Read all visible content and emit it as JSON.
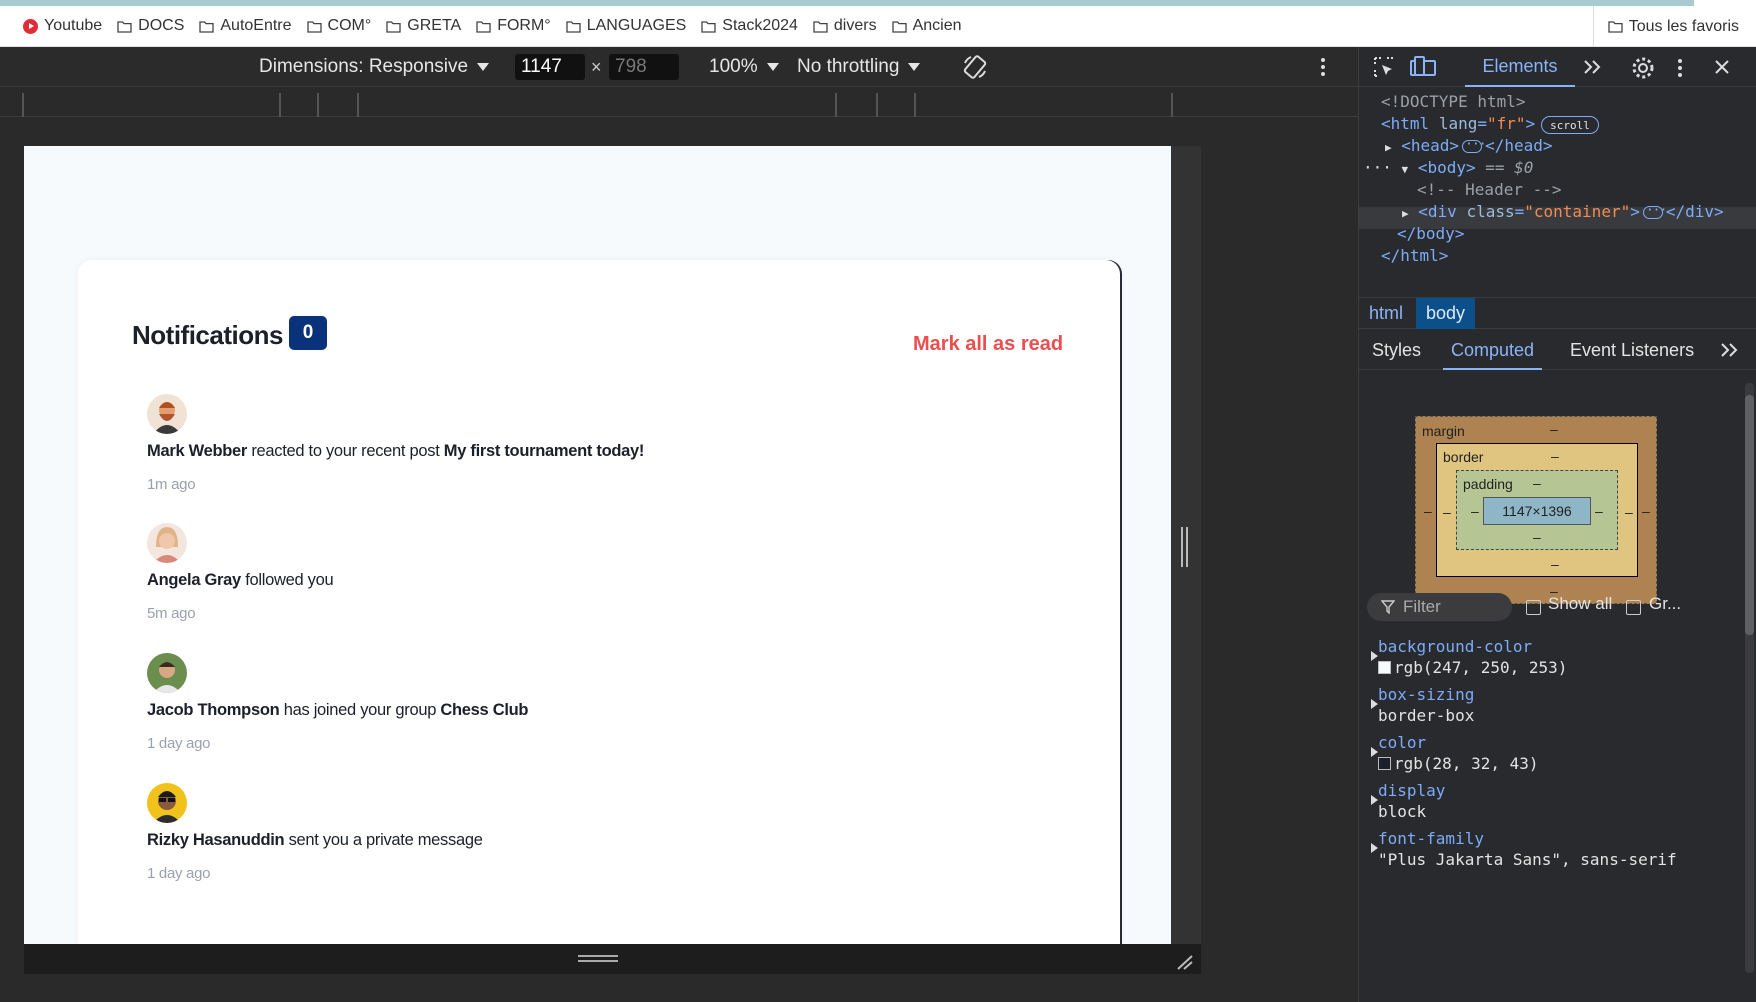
{
  "bookmarks": {
    "items": [
      {
        "label": "Youtube",
        "icon": "youtube-icon"
      },
      {
        "label": "DOCS",
        "icon": "folder-icon"
      },
      {
        "label": "AutoEntre",
        "icon": "folder-icon"
      },
      {
        "label": "COM°",
        "icon": "folder-icon"
      },
      {
        "label": "GRETA",
        "icon": "folder-icon"
      },
      {
        "label": "FORM°",
        "icon": "folder-icon"
      },
      {
        "label": "LANGUAGES",
        "icon": "folder-icon"
      },
      {
        "label": "Stack2024",
        "icon": "folder-icon"
      },
      {
        "label": "divers",
        "icon": "folder-icon"
      },
      {
        "label": "Ancien",
        "icon": "folder-icon"
      }
    ],
    "all_favorites": "Tous les favoris"
  },
  "device_toolbar": {
    "dimensions": "Dimensions: Responsive",
    "width": "1147",
    "times": "×",
    "height": "798",
    "zoom": "100%",
    "throttling": "No throttling"
  },
  "page": {
    "title": "Notifications",
    "count": "0",
    "mark_all": "Mark all as read",
    "notifications": [
      {
        "name": "Mark Webber",
        "action": "reacted to your recent post",
        "target": "My first tournament today!",
        "time": "1m ago"
      },
      {
        "name": "Angela Gray",
        "action": "followed you",
        "target": "",
        "time": "5m ago"
      },
      {
        "name": "Jacob Thompson",
        "action": "has joined your group",
        "target": "Chess Club",
        "time": "1 day ago"
      },
      {
        "name": "Rizky Hasanuddin",
        "action": "sent you a private message",
        "target": "",
        "time": "1 day ago"
      }
    ]
  },
  "devtools": {
    "tab": "Elements",
    "dom": {
      "doctype": "<!DOCTYPE html>",
      "html_open": "<html",
      "lang_attr": "lang",
      "lang_val": "\"fr\"",
      "scroll_badge": "scroll",
      "head_open": "<head>",
      "head_close": "</head>",
      "body_open": "<body>",
      "body_eq": "== $0",
      "comment": "<!-- Header -->",
      "div_open": "<div",
      "class_attr": "class",
      "class_val": "\"container\"",
      "div_close": "</div>",
      "body_close": "</body>",
      "html_close": "</html>"
    },
    "breadcrumbs": [
      "html",
      "body"
    ],
    "subtabs": [
      "Styles",
      "Computed",
      "Event Listeners"
    ],
    "box_model": {
      "margin": "margin",
      "border": "border",
      "padding": "padding",
      "content": "1147×1396",
      "dash": "–"
    },
    "filter": {
      "placeholder": "Filter",
      "show_all": "Show all",
      "group": "Gr..."
    },
    "computed": [
      {
        "name": "background-color",
        "value": "rgb(247, 250, 253)",
        "swatch": "#f7fafd"
      },
      {
        "name": "box-sizing",
        "value": "border-box"
      },
      {
        "name": "color",
        "value": "rgb(28, 32, 43)",
        "swatch": "#1c202b"
      },
      {
        "name": "display",
        "value": "block"
      },
      {
        "name": "font-family",
        "value": "\"Plus Jakarta Sans\", sans-serif"
      }
    ]
  },
  "colors": {
    "accent": "#0a327b",
    "mark_read": "#ec4e4e",
    "devtools_link": "#8ab4f8"
  }
}
